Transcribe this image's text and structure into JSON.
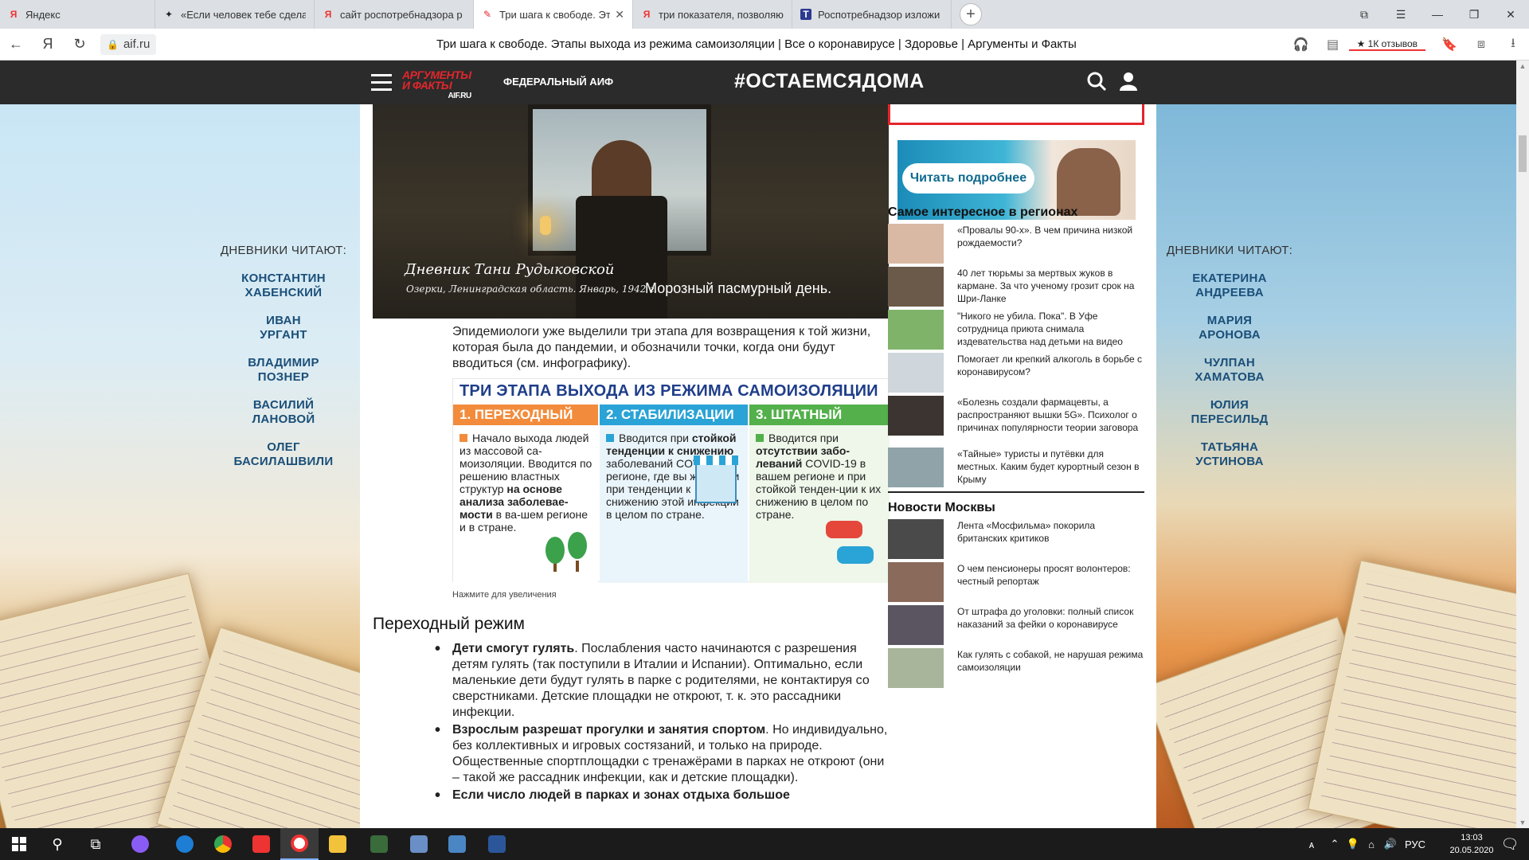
{
  "browser": {
    "tabs": [
      {
        "label": "Яндекс",
        "favicon": "Я",
        "color": "#e33"
      },
      {
        "label": "«Если человек тебе сдела",
        "favicon": "✦",
        "color": "#222"
      },
      {
        "label": "сайт роспотребнадзора р",
        "favicon": "Я",
        "color": "#e33"
      },
      {
        "label": "Три шага к свободе. Эт",
        "favicon": "✎",
        "color": "#e2262c",
        "active": true
      },
      {
        "label": "три показателя, позволяю",
        "favicon": "Я",
        "color": "#e33"
      },
      {
        "label": "Роспотребнадзор изложи",
        "favicon": "T",
        "color": "#2c3b8f"
      }
    ],
    "close_glyph": "✕",
    "new_tab": "+",
    "url": "aif.ru",
    "page_title": "Три шага к свободе. Этапы выхода из режима самоизоляции | Все о коронавирусе | Здоровье | Аргументы и Факты",
    "reviews": "★ 1К отзывов",
    "yandex_glyph": "Я"
  },
  "header": {
    "logo_top": "АРГУМЕНТЫ",
    "logo_bottom": "И ФАКТЫ",
    "logo_domain": "AIF.RU",
    "federal": "ФЕДЕРАЛЬНЫЙ АИФ",
    "hashtag": "#ОСТАЕМСЯДОМА"
  },
  "diaries_left": {
    "heading": "ДНЕВНИКИ ЧИТАЮТ:",
    "names": [
      [
        "КОНСТАНТИН",
        "ХАБЕНСКИЙ"
      ],
      [
        "ИВАН",
        "УРГАНТ"
      ],
      [
        "ВЛАДИМИР",
        "ПОЗНЕР"
      ],
      [
        "ВАСИЛИЙ",
        "ЛАНОВОЙ"
      ],
      [
        "ОЛЕГ",
        "БАСИЛАШВИЛИ"
      ]
    ]
  },
  "diaries_right": {
    "heading": "ДНЕВНИКИ ЧИТАЮТ:",
    "names": [
      [
        "ЕКАТЕРИНА",
        "АНДРЕЕВА"
      ],
      [
        "МАРИЯ",
        "АРОНОВА"
      ],
      [
        "ЧУЛПАН",
        "ХАМАТОВА"
      ],
      [
        "ЮЛИЯ",
        "ПЕРЕСИЛЬД"
      ],
      [
        "ТАТЬЯНА",
        "УСТИНОВА"
      ]
    ]
  },
  "hero": {
    "signature": "Дневник Тани Рудыковской",
    "place": "Озерки, Ленинградская область. Январь, 1942 г.",
    "caption": "Морозный пасмурный день."
  },
  "article": {
    "intro": "Эпидемиологи уже выделили три этапа для возвращения к той жизни, которая была до пандемии, и обозначили точки, когда они будут вводиться (см. инфографику).",
    "infographic": {
      "title": "ТРИ ЭТАПА ВЫХОДА ИЗ РЕЖИМА САМОИЗОЛЯЦИИ",
      "stage1": {
        "title": "1. ПЕРЕХОДНЫЙ",
        "text_a": "Начало выхода людей из массовой са-моизоляции. Вводится по решению властных структур ",
        "bold": "на основе анализа заболевае-мости",
        "text_b": " в ва-шем регионе и в стране."
      },
      "stage2": {
        "title": "2. СТАБИЛИЗАЦИИ",
        "text_a": "Вводится при ",
        "bold": "стойкой тенденции к снижению",
        "text_b": " заболеваний COVID-19 в регионе, где вы живёте, и при тенденции к снижению этой инфекции в целом по стране."
      },
      "stage3": {
        "title": "3. ШТАТНЫЙ",
        "text_a": "Вводится при ",
        "bold": "отсутствии забо-леваний",
        "text_b": " COVID-19 в вашем регионе и при стойкой тенден-ции к их снижению в целом по стране."
      }
    },
    "click_to_zoom": "Нажмите для увеличения",
    "section_title": "Переходный режим",
    "bullets": [
      {
        "bold": "Дети смогут гулять",
        "text": ". Послабления часто начинаются с разрешения детям гулять (так поступили в Италии и Испании). Оптимально, если маленькие дети будут гулять в парке с родителями, не контактируя со сверстниками. Детские площадки не откроют, т. к. это рассадники инфекции."
      },
      {
        "bold": "Взрослым разрешат прогулки и занятия спортом",
        "text": ". Но индивидуально, без коллективных и игровых состязаний, и только на природе. Общественные спортплощадки с тренажёрами в парках не откроют (они – такой же рассадник инфекции, как и детские площадки)."
      },
      {
        "bold": "Если число людей в парках и зонах отдыха большое",
        "text": ""
      }
    ]
  },
  "sidebar": {
    "banner_button": "Читать подробнее",
    "regions_title": "Самое интересное в регионах",
    "regions": [
      {
        "text": "«Провалы 90-х». В чем причина низкой рождаемости?",
        "thumb": "#d9b9a3"
      },
      {
        "text": "40 лет тюрьмы за мертвых жуков в кармане. За что ученому грозит срок на Шри-Ланке",
        "thumb": "#6b5a4a"
      },
      {
        "text": "\"Никого не убила. Пока\". В Уфе сотрудница приюта снимала издевательства над детьми на видео",
        "thumb": "#7fb36a"
      },
      {
        "text": "Помогает ли крепкий алкоголь в борьбе с коронавирусом?",
        "thumb": "#cfd6dc"
      },
      {
        "text": "«Болезнь создали фармацевты, а распространяют вышки 5G». Психолог о причинах популярности теории заговора",
        "thumb": "#3c3430"
      },
      {
        "text": "«Тайные» туристы и путёвки для местных. Каким будет курортный сезон в Крыму",
        "thumb": "#8fa3a8"
      }
    ],
    "moscow_title": "Новости Москвы",
    "moscow": [
      {
        "text": "Лента «Мосфильма» покорила британских критиков",
        "thumb": "#4a4a4a"
      },
      {
        "text": "О чем пенсионеры просят волонтеров: честный репортаж",
        "thumb": "#8a6a5a"
      },
      {
        "text": "От штрафа до уголовки: полный список наказаний за фейки о коронавирусе",
        "thumb": "#5a5560"
      },
      {
        "text": "Как гулять с собакой, не нарушая режима самоизоляции",
        "thumb": "#a8b59a"
      }
    ]
  },
  "taskbar": {
    "lang": "РУС",
    "time": "13:03",
    "date": "20.05.2020"
  }
}
